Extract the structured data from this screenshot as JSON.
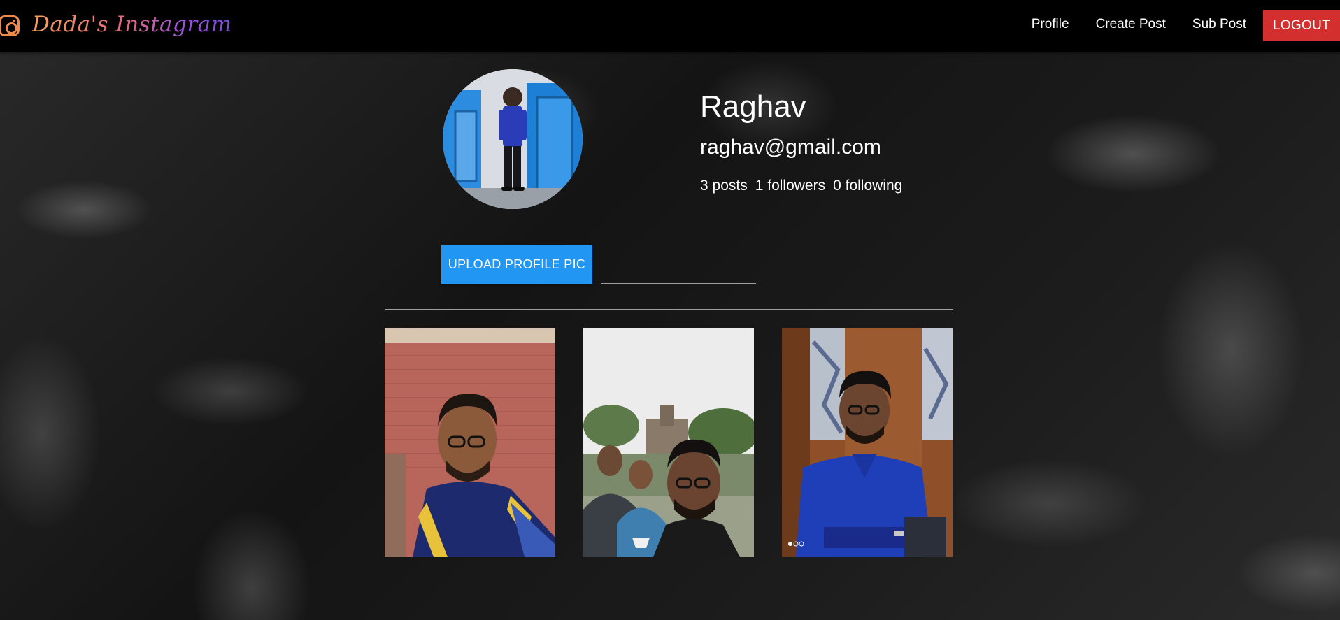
{
  "navbar": {
    "brand": "Dada's Instagram",
    "brand_icon": "instagram-icon",
    "links": [
      {
        "label": "Profile"
      },
      {
        "label": "Create Post"
      },
      {
        "label": "Sub Post"
      }
    ],
    "logout_label": "LOGOUT",
    "logout_color": "#d32f2f"
  },
  "profile": {
    "name": "Raghav",
    "email": "raghav@gmail.com",
    "stats": {
      "posts": "3 posts",
      "followers": "1 followers",
      "following": "0 following"
    },
    "upload_label": "UPLOAD PROFILE PIC",
    "upload_color": "#2196f3",
    "file_path_value": ""
  },
  "gallery": {
    "items": [
      {
        "name": "post-photo-1"
      },
      {
        "name": "post-photo-2"
      },
      {
        "name": "post-photo-3"
      }
    ]
  }
}
